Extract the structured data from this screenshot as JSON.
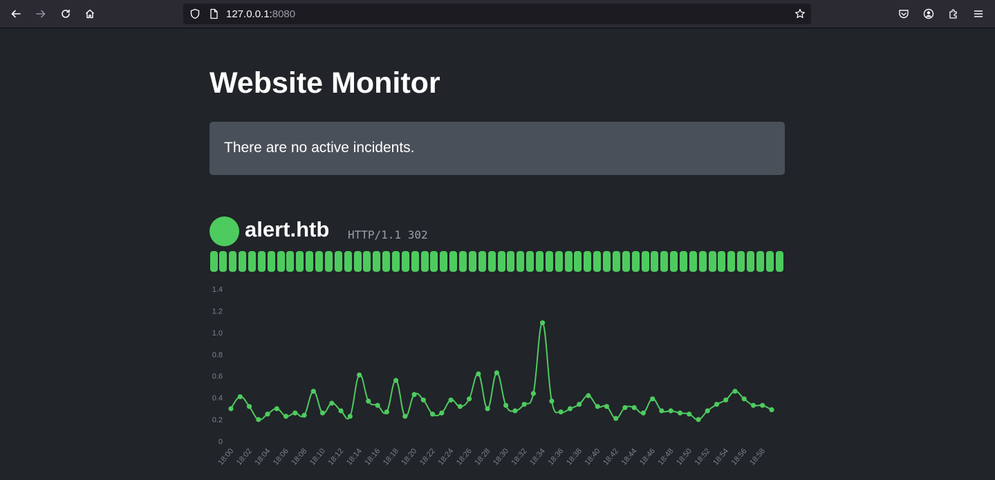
{
  "browser": {
    "url_host": "127.0.0.1:",
    "url_port": "8080"
  },
  "page": {
    "title": "Website Monitor",
    "incident_message": "There are no active incidents."
  },
  "monitor": {
    "site": "alert.htb",
    "status": "HTTP/1.1 302",
    "status_color": "#4ecb5f",
    "uptime_checks": [
      "up",
      "up",
      "up",
      "up",
      "up",
      "up",
      "up",
      "up",
      "up",
      "up",
      "up",
      "up",
      "up",
      "up",
      "up",
      "up",
      "up",
      "up",
      "up",
      "up",
      "up",
      "up",
      "up",
      "up",
      "up",
      "up",
      "up",
      "up",
      "up",
      "up",
      "up",
      "up",
      "up",
      "up",
      "up",
      "up",
      "up",
      "up",
      "up",
      "up",
      "up",
      "up",
      "up",
      "up",
      "up",
      "up",
      "up",
      "up",
      "up",
      "up",
      "up",
      "up",
      "up",
      "up",
      "up",
      "up",
      "up",
      "up",
      "up",
      "up"
    ]
  },
  "chart_data": {
    "type": "line",
    "x": [
      "18:00",
      "18:01",
      "18:02",
      "18:03",
      "18:04",
      "18:05",
      "18:06",
      "18:07",
      "18:08",
      "18:09",
      "18:10",
      "18:11",
      "18:12",
      "18:13",
      "18:14",
      "18:15",
      "18:16",
      "18:17",
      "18:18",
      "18:19",
      "18:20",
      "18:21",
      "18:22",
      "18:23",
      "18:24",
      "18:25",
      "18:26",
      "18:27",
      "18:28",
      "18:29",
      "18:30",
      "18:31",
      "18:32",
      "18:33",
      "18:34",
      "18:35",
      "18:36",
      "18:37",
      "18:38",
      "18:39",
      "18:40",
      "18:41",
      "18:42",
      "18:43",
      "18:44",
      "18:45",
      "18:46",
      "18:47",
      "18:48",
      "18:49",
      "18:50",
      "18:51",
      "18:52",
      "18:53",
      "18:54",
      "18:55",
      "18:56",
      "18:57",
      "18:58",
      "18:59"
    ],
    "x_tick_labels": [
      "18:00",
      "18:02",
      "18:04",
      "18:06",
      "18:08",
      "18:10",
      "18:12",
      "18:14",
      "18:16",
      "18:18",
      "18:20",
      "18:22",
      "18:24",
      "18:26",
      "18:28",
      "18:30",
      "18:32",
      "18:34",
      "18:36",
      "18:38",
      "18:40",
      "18:42",
      "18:44",
      "18:46",
      "18:48",
      "18:50",
      "18:52",
      "18:54",
      "18:56",
      "18:58"
    ],
    "values": [
      0.3,
      0.41,
      0.32,
      0.2,
      0.25,
      0.3,
      0.23,
      0.26,
      0.24,
      0.46,
      0.26,
      0.35,
      0.28,
      0.23,
      0.61,
      0.37,
      0.33,
      0.27,
      0.56,
      0.23,
      0.43,
      0.38,
      0.25,
      0.26,
      0.38,
      0.32,
      0.39,
      0.62,
      0.3,
      0.63,
      0.33,
      0.28,
      0.34,
      0.44,
      1.09,
      0.37,
      0.27,
      0.3,
      0.34,
      0.42,
      0.32,
      0.32,
      0.21,
      0.31,
      0.31,
      0.26,
      0.39,
      0.28,
      0.28,
      0.26,
      0.25,
      0.2,
      0.28,
      0.34,
      0.38,
      0.46,
      0.39,
      0.33,
      0.33,
      0.29
    ],
    "y_ticks": [
      "1.4",
      "1.2",
      "1.0",
      "0.8",
      "0.6",
      "0.4",
      "0.2",
      "0"
    ],
    "ylim": [
      0,
      1.4
    ],
    "grid": false,
    "color": "#4ecb5f"
  }
}
